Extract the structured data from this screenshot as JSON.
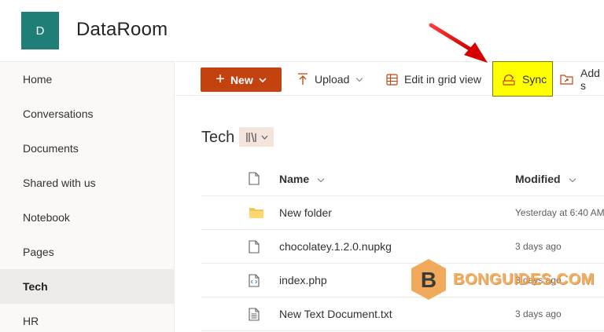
{
  "site": {
    "logo_letter": "D",
    "title": "DataRoom"
  },
  "sidebar": {
    "items": [
      {
        "label": "Home"
      },
      {
        "label": "Conversations"
      },
      {
        "label": "Documents"
      },
      {
        "label": "Shared with us"
      },
      {
        "label": "Notebook"
      },
      {
        "label": "Pages"
      },
      {
        "label": "Tech",
        "active": true
      },
      {
        "label": "HR"
      }
    ]
  },
  "commandbar": {
    "new_label": "New",
    "upload_label": "Upload",
    "grid_label": "Edit in grid view",
    "sync_label": "Sync",
    "add_label": "Add s"
  },
  "library": {
    "title": "Tech"
  },
  "table": {
    "headers": {
      "name": "Name",
      "modified": "Modified"
    },
    "rows": [
      {
        "name": "New folder",
        "modified": "Yesterday at 6:40 AM",
        "icon": "folder-icon"
      },
      {
        "name": "chocolatey.1.2.0.nupkg",
        "modified": "3 days ago",
        "icon": "file-icon"
      },
      {
        "name": "index.php",
        "modified": "3 days ago",
        "icon": "code-file-icon"
      },
      {
        "name": "New Text Document.txt",
        "modified": "3 days ago",
        "icon": "text-file-icon"
      }
    ]
  },
  "watermark": {
    "text": "BONGUIDES.COM",
    "letter": "B"
  },
  "colors": {
    "accent": "#c4420f",
    "brand": "#1f7f78",
    "highlight": "#ffff00",
    "arrow": "#e00000"
  }
}
